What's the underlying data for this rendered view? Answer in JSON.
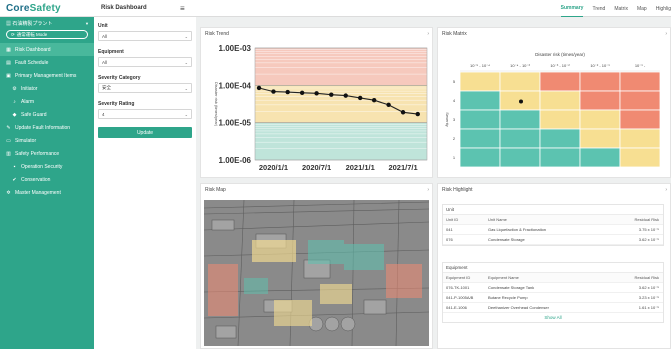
{
  "app": {
    "logo_main": "Core",
    "logo_accent": "Safety",
    "plant_name": "石油精製プラント",
    "mode_label": "通常運転 Mode"
  },
  "nav": {
    "items": [
      {
        "label": "Risk Dashboard",
        "icon": "grid-icon",
        "active": true,
        "sub": false
      },
      {
        "label": "Fault Schedule",
        "icon": "calendar-icon",
        "active": false,
        "sub": false
      },
      {
        "label": "Primary Management Items",
        "icon": "list-icon",
        "active": false,
        "sub": false
      },
      {
        "label": "Initiator",
        "icon": "gear-icon",
        "active": false,
        "sub": true
      },
      {
        "label": "Alarm",
        "icon": "bell-icon",
        "active": false,
        "sub": true
      },
      {
        "label": "Safe Guard",
        "icon": "shield-icon",
        "active": false,
        "sub": true
      },
      {
        "label": "Update Fault Information",
        "icon": "wrench-icon",
        "active": false,
        "sub": false
      },
      {
        "label": "Simulator",
        "icon": "monitor-icon",
        "active": false,
        "sub": false
      },
      {
        "label": "Safety Performance",
        "icon": "chart-icon",
        "active": false,
        "sub": false
      },
      {
        "label": "Operation Security",
        "icon": "lock-icon",
        "active": false,
        "sub": true
      },
      {
        "label": "Conservation",
        "icon": "check-icon",
        "active": false,
        "sub": true
      },
      {
        "label": "Master Management",
        "icon": "settings-icon",
        "active": false,
        "sub": false
      }
    ]
  },
  "header": {
    "title": "Risk Dashboard",
    "tabs": [
      "Summary",
      "Trend",
      "Matrix",
      "Map",
      "Highlig"
    ]
  },
  "filters": {
    "unit_label": "Unit",
    "unit_value": "All",
    "equipment_label": "Equipment",
    "equipment_value": "All",
    "severity_category_label": "Severity Category",
    "severity_category_value": "安全",
    "severity_rating_label": "Severity Rating",
    "severity_rating_value": "4",
    "update_label": "Update"
  },
  "cards": {
    "trend_title": "Risk Trend",
    "matrix_title": "Risk Matrix",
    "map_title": "Risk Map",
    "highlight_title": "Risk Highlight"
  },
  "chart_data": [
    {
      "type": "line",
      "title": "",
      "ylabel": "Disaster risk (times/year)",
      "xlabel": "",
      "y_scale": "log",
      "ylim": [
        1e-06,
        0.001
      ],
      "y_ticks": [
        "1.00E-03",
        "1.00E-04",
        "1.00E-05",
        "1.00E-06"
      ],
      "x_ticks": [
        "2020/1/1",
        "2020/7/1",
        "2021/1/1",
        "2021/7/1"
      ],
      "x": [
        "2019/11/1",
        "2020/1/1",
        "2020/3/1",
        "2020/5/1",
        "2020/7/1",
        "2020/9/1",
        "2020/11/1",
        "2021/1/1",
        "2021/3/1",
        "2021/5/1",
        "2021/7/1",
        "2021/9/1"
      ],
      "values": [
        8.5e-05,
        6.8e-05,
        6.6e-05,
        6.3e-05,
        6.1e-05,
        5.6e-05,
        5.3e-05,
        4.6e-05,
        4e-05,
        3e-05,
        1.9e-05,
        1.7e-05
      ],
      "bands": [
        {
          "from": 0.0001,
          "to": 0.001,
          "color": "#f6c9bd"
        },
        {
          "from": 1e-05,
          "to": 0.0001,
          "color": "#f7e3b0"
        },
        {
          "from": 1e-06,
          "to": 1e-05,
          "color": "#bfe4da"
        }
      ],
      "grid": true
    },
    {
      "type": "heatmap",
      "title": "Disaster risk (times/year)",
      "ylabel": "Severity",
      "columns": [
        "10⁻⁵ - 10⁻⁴",
        "10⁻⁴ - 10⁻³",
        "10⁻³ - 10⁻²",
        "10⁻² - 10⁻¹",
        "10⁻¹ -"
      ],
      "rows": [
        "5",
        "4",
        "3",
        "2",
        "1"
      ],
      "cell_colors": [
        [
          "#f7df92",
          "#f7df92",
          "#f08a72",
          "#f08a72",
          "#f08a72"
        ],
        [
          "#5cc3b0",
          "#f7df92",
          "#f7df92",
          "#f08a72",
          "#f08a72"
        ],
        [
          "#5cc3b0",
          "#5cc3b0",
          "#f7df92",
          "#f7df92",
          "#f08a72"
        ],
        [
          "#5cc3b0",
          "#5cc3b0",
          "#5cc3b0",
          "#f7df92",
          "#f7df92"
        ],
        [
          "#5cc3b0",
          "#5cc3b0",
          "#5cc3b0",
          "#5cc3b0",
          "#f7df92"
        ]
      ],
      "marker": {
        "row": "4",
        "column": "10⁻⁴ - 10⁻³"
      }
    }
  ],
  "highlight": {
    "unit_section": "Unit",
    "unit_headers": [
      "Unit ID",
      "Unit Name",
      "Residual Risk"
    ],
    "unit_rows": [
      [
        "041",
        "Gas Liquefaction & Fractionation",
        "3.75 x 10⁻⁵"
      ],
      [
        "076",
        "Condensate Storage",
        "3.62 x 10⁻⁵"
      ]
    ],
    "equipment_section": "Equipment",
    "equipment_headers": [
      "Equipment ID",
      "Equipment Name",
      "Residual Risk"
    ],
    "equipment_rows": [
      [
        "076-TK-1001",
        "Condensate Storage Tank",
        "3.62 x 10⁻⁵"
      ],
      [
        "041-P-1005A/B",
        "Butane Recycle Pump",
        "3.23 x 10⁻⁵"
      ],
      [
        "041-E-1006",
        "Deethanizer Overhead Condenser",
        "1.61 x 10⁻⁵"
      ]
    ],
    "show_all": "Show All"
  }
}
